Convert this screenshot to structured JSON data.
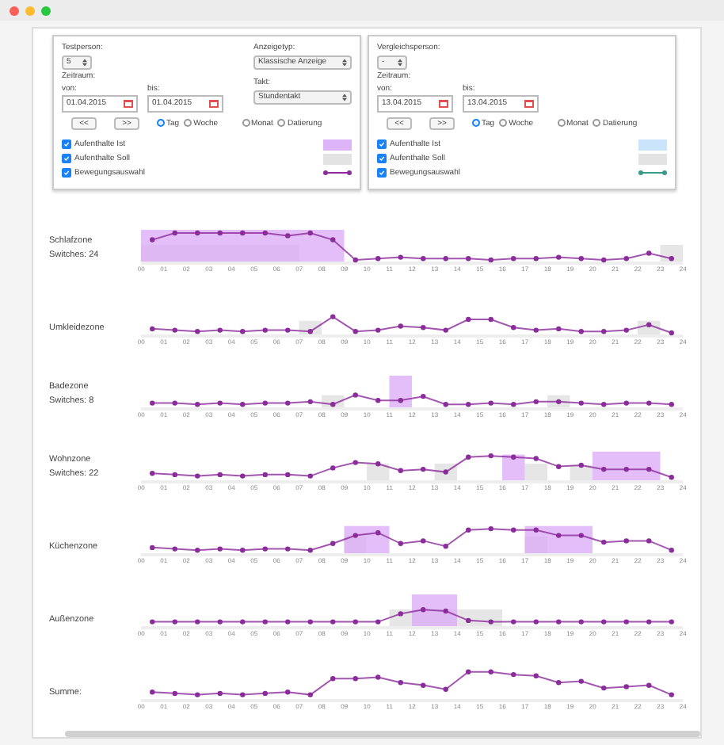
{
  "panels": [
    {
      "person_label": "Testperson:",
      "person_value": "5",
      "type_label": "Anzeigetyp:",
      "type_value": "Klassische Anzeige",
      "period_label": "Zeitraum:",
      "from_label": "von:",
      "from_value": "01.04.2015",
      "to_label": "bis:",
      "to_value": "01.04.2015",
      "interval_label": "Takt:",
      "interval_value": "Stundentakt",
      "prev_button": "<<",
      "next_button": ">>",
      "modes": [
        {
          "label": "Tag",
          "selected": true
        },
        {
          "label": "Woche",
          "selected": false
        },
        {
          "label": "Monat",
          "selected": false
        },
        {
          "label": "Datierung",
          "selected": false
        }
      ],
      "options": [
        {
          "label": "Aufenthalte Ist",
          "checked": true,
          "kind": "area",
          "color": "#dcb4f7"
        },
        {
          "label": "Aufenthalte Soll",
          "checked": true,
          "kind": "area",
          "color": "#e3e3e3"
        },
        {
          "label": "Bewegungsauswahl",
          "checked": true,
          "kind": "line",
          "color": "#8b2c9b"
        }
      ]
    },
    {
      "person_label": "Vergleichsperson:",
      "person_value": "-",
      "period_label": "Zeitraum:",
      "from_label": "von:",
      "from_value": "13.04.2015",
      "to_label": "bis:",
      "to_value": "13.04.2015",
      "prev_button": "<<",
      "next_button": ">>",
      "modes": [
        {
          "label": "Tag",
          "selected": true
        },
        {
          "label": "Woche",
          "selected": false
        },
        {
          "label": "Monat",
          "selected": false
        },
        {
          "label": "Datierung",
          "selected": false
        }
      ],
      "options": [
        {
          "label": "Aufenthalte Ist",
          "checked": true,
          "kind": "area",
          "color": "#c9e4fb"
        },
        {
          "label": "Aufenthalte Soll",
          "checked": true,
          "kind": "area",
          "color": "#e3e3e3"
        },
        {
          "label": "Bewegungsauswahl",
          "checked": true,
          "kind": "line",
          "color": "#3a9a8a"
        }
      ]
    }
  ],
  "zones": [
    {
      "name": "Schlafzone",
      "switches": "Switches: 24",
      "hours": [
        "00",
        "01",
        "02",
        "03",
        "04",
        "05",
        "06",
        "07",
        "08",
        "09",
        "10",
        "11",
        "12",
        "13",
        "14",
        "15",
        "16",
        "17",
        "18",
        "19",
        "20",
        "21",
        "22",
        "23",
        "24"
      ]
    },
    {
      "name": "Umkleidezone",
      "hours": [
        "00",
        "01",
        "02",
        "03",
        "04",
        "05",
        "06",
        "07",
        "08",
        "09",
        "10",
        "11",
        "12",
        "13",
        "14",
        "15",
        "16",
        "17",
        "18",
        "19",
        "20",
        "21",
        "22",
        "23",
        "24"
      ]
    },
    {
      "name": "Badezone",
      "switches": "Switches: 8",
      "hours": [
        "00",
        "01",
        "02",
        "03",
        "04",
        "05",
        "06",
        "07",
        "08",
        "09",
        "10",
        "11",
        "12",
        "13",
        "14",
        "15",
        "16",
        "17",
        "18",
        "19",
        "20",
        "21",
        "22",
        "23",
        "24"
      ]
    },
    {
      "name": "Wohnzone",
      "switches": "Switches: 22",
      "hours": [
        "00",
        "01",
        "02",
        "03",
        "04",
        "05",
        "06",
        "07",
        "08",
        "09",
        "10",
        "11",
        "12",
        "13",
        "14",
        "15",
        "16",
        "17",
        "18",
        "19",
        "20",
        "21",
        "22",
        "23",
        "24"
      ]
    },
    {
      "name": "Küchenzone",
      "hours": [
        "00",
        "01",
        "02",
        "03",
        "04",
        "05",
        "06",
        "07",
        "08",
        "09",
        "10",
        "11",
        "12",
        "13",
        "14",
        "15",
        "16",
        "17",
        "18",
        "19",
        "20",
        "21",
        "22",
        "23",
        "24"
      ]
    },
    {
      "name": "Außenzone",
      "hours": [
        "00",
        "01",
        "02",
        "03",
        "04",
        "05",
        "06",
        "07",
        "08",
        "09",
        "10",
        "11",
        "12",
        "13",
        "14",
        "15",
        "16",
        "17",
        "18",
        "19",
        "20",
        "21",
        "22",
        "23",
        "24"
      ]
    },
    {
      "name": "Summe:",
      "hours": [
        "00",
        "01",
        "02",
        "03",
        "04",
        "05",
        "06",
        "07",
        "08",
        "09",
        "10",
        "11",
        "12",
        "13",
        "14",
        "15",
        "16",
        "17",
        "18",
        "19",
        "20",
        "21",
        "22",
        "23",
        "24"
      ]
    }
  ]
}
